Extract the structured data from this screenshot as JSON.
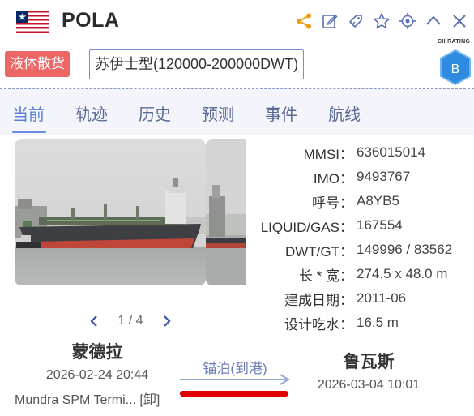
{
  "header": {
    "ship_name": "POLA",
    "flag_icon": "liberia-flag-icon",
    "actions": [
      "share-icon",
      "edit-icon",
      "tag-icon",
      "star-icon",
      "locate-icon",
      "collapse-icon",
      "close-icon"
    ],
    "accent_color": "#f39c12"
  },
  "tags": {
    "cargo_type": "液体散货",
    "size_class": "苏伊士型(120000-200000DWT)"
  },
  "cii": {
    "label": "CII RATING",
    "grade": "B",
    "color": "#2f8be0"
  },
  "tabs": [
    {
      "label": "当前",
      "active": true
    },
    {
      "label": "轨迹",
      "active": false
    },
    {
      "label": "历史",
      "active": false
    },
    {
      "label": "预测",
      "active": false
    },
    {
      "label": "事件",
      "active": false
    },
    {
      "label": "航线",
      "active": false
    }
  ],
  "gallery": {
    "pager": "1 / 4"
  },
  "info": [
    {
      "key": "MMSI：",
      "value": "636015014"
    },
    {
      "key": "IMO：",
      "value": "9493767"
    },
    {
      "key": "呼号：",
      "value": "A8YB5"
    },
    {
      "key": "LIQUID/GAS：",
      "value": "167554"
    },
    {
      "key": "DWT/GT：",
      "value": "149996 / 83562"
    },
    {
      "key": "长 * 宽：",
      "value": "274.5 x 48.0 m"
    },
    {
      "key": "建成日期：",
      "value": "2011-06"
    },
    {
      "key": "设计吃水：",
      "value": "16.5 m"
    }
  ],
  "voyage": {
    "from_port": "蒙德拉",
    "from_date": "2026-02-24 20:44",
    "from_terminal": "Mundra SPM Termi... [卸]",
    "status": "锚泊(到港)",
    "to_port": "鲁瓦斯",
    "to_date": "2026-03-04 10:01"
  }
}
